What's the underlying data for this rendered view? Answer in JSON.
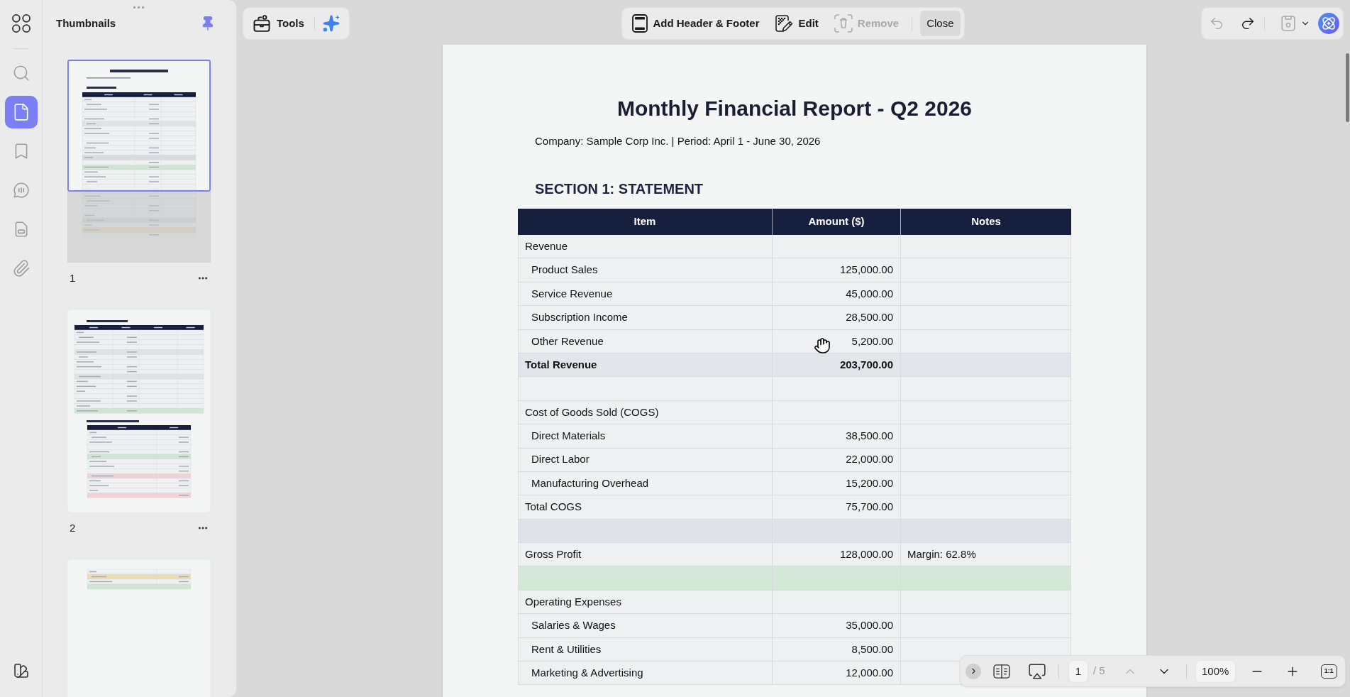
{
  "sidebar": {
    "items": [
      {
        "kind": "search",
        "selected": false
      },
      {
        "kind": "pages",
        "selected": true
      },
      {
        "kind": "bookmarks",
        "selected": false
      },
      {
        "kind": "comments",
        "selected": false
      },
      {
        "kind": "forms",
        "selected": false
      },
      {
        "kind": "attachments",
        "selected": false
      }
    ]
  },
  "thumbnails": {
    "title": "Thumbnails",
    "pinned": true,
    "pages": [
      {
        "label": "1",
        "selected": true
      },
      {
        "label": "2",
        "selected": false
      },
      {
        "selected": false
      }
    ]
  },
  "toolbar": {
    "tools": {
      "label": "Tools"
    },
    "header_footer": [
      {
        "kind": "add",
        "label": "Add Header & Footer",
        "disabled": false
      },
      {
        "kind": "edit",
        "label": "Edit",
        "disabled": false
      },
      {
        "kind": "remove",
        "label": "Remove",
        "disabled": true
      },
      {
        "kind": "close",
        "label": "Close",
        "disabled": false
      }
    ],
    "actions": [
      {
        "kind": "undo",
        "disabled": true
      },
      {
        "kind": "redo",
        "disabled": false
      },
      {
        "kind": "save",
        "disabled": true
      }
    ]
  },
  "document": {
    "title": "Monthly Financial Report - Q2 2026",
    "subtitle": "Company: Sample Corp Inc. | Period: April 1 - June 30, 2026",
    "section_title": "SECTION 1: STATEMENT",
    "table": {
      "columns": [
        "Item",
        "Amount ($)",
        "Notes"
      ],
      "rows": [
        {
          "kind": "section",
          "item": "Revenue"
        },
        {
          "kind": "item",
          "item": "Product Sales",
          "amount": "125,000.00"
        },
        {
          "kind": "item",
          "item": "Service Revenue",
          "amount": "45,000.00"
        },
        {
          "kind": "item",
          "item": "Subscription Income",
          "amount": "28,500.00"
        },
        {
          "kind": "item",
          "item": "Other Revenue",
          "amount": "5,200.00"
        },
        {
          "kind": "total",
          "item": "Total Revenue",
          "amount": "203,700.00",
          "color": "#e2e5e9"
        },
        {
          "kind": "blank"
        },
        {
          "kind": "section",
          "item": "Cost of Goods Sold (COGS)"
        },
        {
          "kind": "item",
          "item": "Direct Materials",
          "amount": "38,500.00"
        },
        {
          "kind": "item",
          "item": "Direct Labor",
          "amount": "22,000.00"
        },
        {
          "kind": "item",
          "item": "Manufacturing Overhead",
          "amount": "15,200.00"
        },
        {
          "kind": "section",
          "item": "Total COGS",
          "amount": "75,700.00"
        },
        {
          "kind": "blank",
          "color": "#dfe2e6"
        },
        {
          "kind": "section",
          "item": "Gross Profit",
          "amount": "128,000.00",
          "notes": "Margin: 62.8%"
        },
        {
          "kind": "blank",
          "color": "#d3e8d7"
        },
        {
          "kind": "section",
          "item": "Operating Expenses"
        },
        {
          "kind": "item",
          "item": "Salaries & Wages",
          "amount": "35,000.00"
        },
        {
          "kind": "item",
          "item": "Rent & Utilities",
          "amount": "8,500.00"
        },
        {
          "kind": "item",
          "item": "Marketing & Advertising",
          "amount": "12,000.00"
        }
      ]
    }
  },
  "page_nav": {
    "page": "1",
    "total": "/ 5",
    "nav": [
      {
        "kind": "previous",
        "disabled": true
      },
      {
        "kind": "next",
        "disabled": false
      }
    ],
    "zoom": "100%",
    "actual_size": "1:1"
  }
}
